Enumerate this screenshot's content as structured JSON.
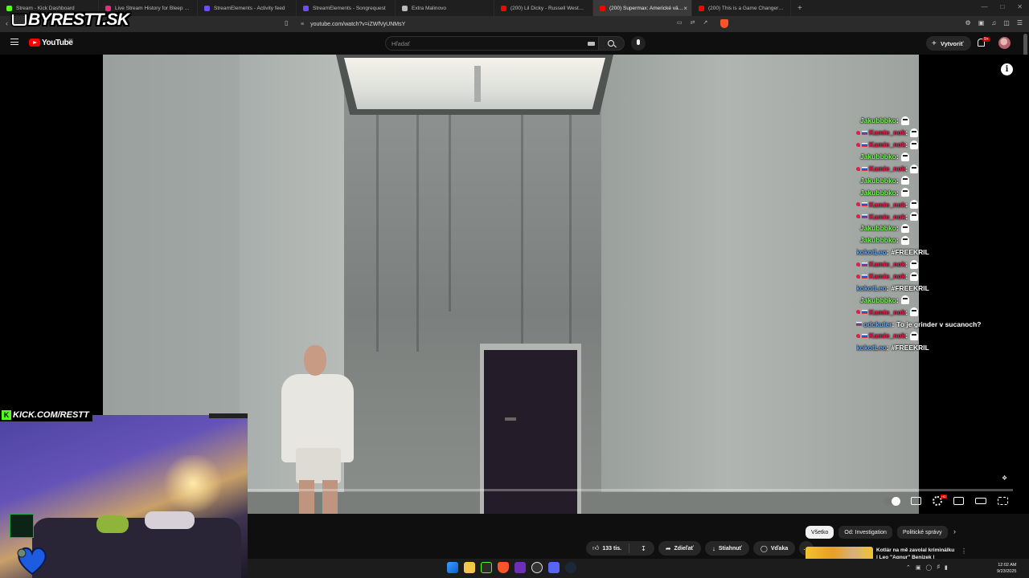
{
  "browser": {
    "tabs": [
      {
        "title": "Stream - Kick Dashboard",
        "favicon_color": "#53fc18",
        "active": false
      },
      {
        "title": "Live Stream History for Bleep Shares",
        "favicon_color": "#e0307a",
        "active": false
      },
      {
        "title": "StreamElements - Activity feed",
        "favicon_color": "#6f4cff",
        "active": false
      },
      {
        "title": "StreamElements - Songrequest",
        "favicon_color": "#6f4cff",
        "active": false
      },
      {
        "title": "Extra Malinovo",
        "favicon_color": "#bbbbbb",
        "active": false
      },
      {
        "title": "(200) Lil Dicky - Russell Westbrook O",
        "favicon_color": "#ff0000",
        "active": false
      },
      {
        "title": "(200) Supermax: Americké väzen",
        "favicon_color": "#ff0000",
        "active": true
      },
      {
        "title": "(200) This is a Game Changer - YouT",
        "favicon_color": "#ff0000",
        "active": false
      }
    ],
    "new_tab": "+",
    "url": "youtube.com/watch?v=iZWfVyUNMsY"
  },
  "overlay": {
    "brand": "BYRESTT.SK",
    "kick": "KICK.COM/RESTT"
  },
  "youtube": {
    "logo": "YouTube",
    "country": "SK",
    "search_placeholder": "Hľadať",
    "create_label": "Vytvoriť",
    "notif_badge": "9+",
    "video_progress": 0.0
  },
  "chat": [
    {
      "user": "Jakubbbko",
      "color": "#7CFC58",
      "badge": "dot",
      "msg": "",
      "emote": true
    },
    {
      "user": "Kamie_nok",
      "color": "#e0204a",
      "badge": "heart",
      "msg": "",
      "emote": true
    },
    {
      "user": "Kamie_nok",
      "color": "#e0204a",
      "badge": "heart",
      "msg": "",
      "emote": true
    },
    {
      "user": "Jakubbbko",
      "color": "#7CFC58",
      "badge": "dot",
      "msg": "",
      "emote": true
    },
    {
      "user": "Kamie_nok",
      "color": "#e0204a",
      "badge": "heart",
      "msg": "",
      "emote": true
    },
    {
      "user": "Jakubbbko",
      "color": "#7CFC58",
      "badge": "dot",
      "msg": "",
      "emote": true
    },
    {
      "user": "Jakubbbko",
      "color": "#7CFC58",
      "badge": "dot",
      "msg": "",
      "emote": true
    },
    {
      "user": "Kamie_nok",
      "color": "#e0204a",
      "badge": "heart",
      "msg": "",
      "emote": true
    },
    {
      "user": "Kamie_nok",
      "color": "#e0204a",
      "badge": "heart",
      "msg": "",
      "emote": true
    },
    {
      "user": "Jakubbbko",
      "color": "#7CFC58",
      "badge": "dot",
      "msg": "",
      "emote": true
    },
    {
      "user": "Jakubbbko",
      "color": "#7CFC58",
      "badge": "dot",
      "msg": "",
      "emote": true
    },
    {
      "user": "kokotLeo",
      "color": "#6aa6e8",
      "badge": "none",
      "msg": "#FREEKRIL",
      "emote": false
    },
    {
      "user": "Kamie_nok",
      "color": "#e0204a",
      "badge": "heart",
      "msg": "",
      "emote": true
    },
    {
      "user": "Kamie_nok",
      "color": "#e0204a",
      "badge": "heart",
      "msg": "",
      "emote": true
    },
    {
      "user": "kokotLeo",
      "color": "#6aa6e8",
      "badge": "none",
      "msg": "#FREEKRIL",
      "emote": false
    },
    {
      "user": "Jakubbbko",
      "color": "#7CFC58",
      "badge": "dot",
      "msg": "",
      "emote": true
    },
    {
      "user": "Kamie_nok",
      "color": "#e0204a",
      "badge": "heart",
      "msg": "",
      "emote": true
    },
    {
      "user": "odckuler",
      "color": "#6aa6e8",
      "badge": "flag",
      "msg": "To je grinder v sucanoch?",
      "emote": false
    },
    {
      "user": "Kamie_nok",
      "color": "#e0204a",
      "badge": "heart",
      "msg": "",
      "emote": true
    },
    {
      "user": "kokotLeo",
      "color": "#6aa6e8",
      "badge": "none",
      "msg": "#FREEKRIL",
      "emote": false
    }
  ],
  "actions": {
    "likes": "133 tis.",
    "share": "Zdieľať",
    "download": "Stiahnuť",
    "thanks": "Vďaka",
    "more": "…"
  },
  "filter_chips": [
    {
      "label": "Všetko",
      "selected": true
    },
    {
      "label": "Od: Investigation",
      "selected": false
    },
    {
      "label": "Politické správy",
      "selected": false
    }
  ],
  "recommendation": {
    "title_line1": "Kotlár na mě zavolal kriminálku",
    "title_line2": "| Leo \"Agnur\" Benizek |"
  },
  "taskbar": {
    "time": "12:02 AM",
    "date": "9/23/2025"
  }
}
